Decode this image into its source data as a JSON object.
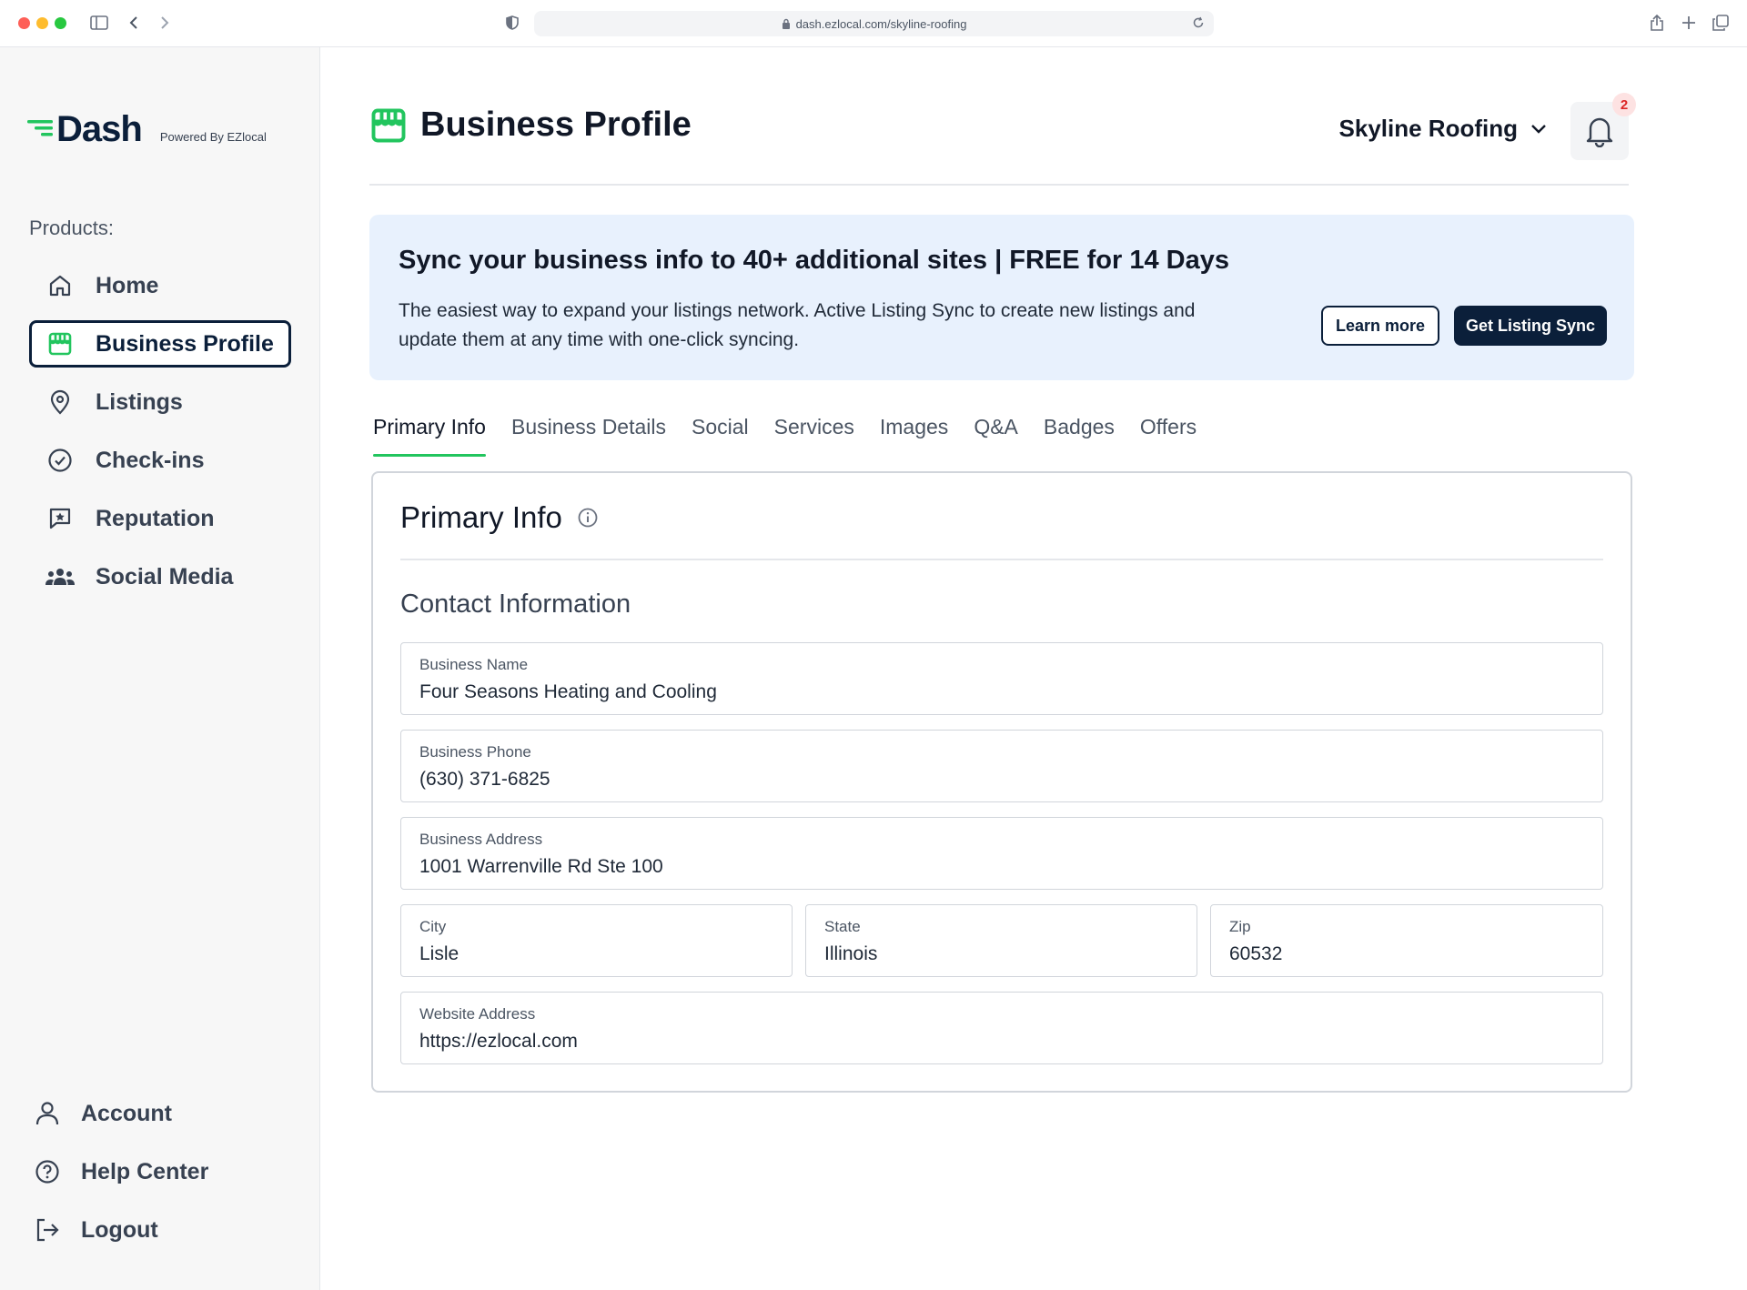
{
  "browser": {
    "url": "dash.ezlocal.com/skyline-roofing"
  },
  "sidebar": {
    "logo_text": "Dash",
    "powered_by": "Powered By EZlocal",
    "products_label": "Products:",
    "items": [
      {
        "label": "Home",
        "icon": "home-icon"
      },
      {
        "label": "Business Profile",
        "icon": "storefront-icon"
      },
      {
        "label": "Listings",
        "icon": "map-pin-icon"
      },
      {
        "label": "Check-ins",
        "icon": "check-circle-icon"
      },
      {
        "label": "Reputation",
        "icon": "star-message-icon"
      },
      {
        "label": "Social Media",
        "icon": "people-icon"
      }
    ],
    "bottom_items": [
      {
        "label": "Account",
        "icon": "user-icon"
      },
      {
        "label": "Help Center",
        "icon": "help-circle-icon"
      },
      {
        "label": "Logout",
        "icon": "logout-icon"
      }
    ]
  },
  "header": {
    "title": "Business Profile",
    "business_name": "Skyline Roofing",
    "notification_count": "2"
  },
  "banner": {
    "title": "Sync your business info to 40+ additional sites | FREE for 14 Days",
    "body": "The easiest way to expand your listings network. Active Listing Sync to create new listings and update them at any time with one-click syncing.",
    "learn_more": "Learn more",
    "cta": "Get Listing Sync"
  },
  "tabs": [
    "Primary Info",
    "Business Details",
    "Social",
    "Services",
    "Images",
    "Q&A",
    "Badges",
    "Offers"
  ],
  "card": {
    "title": "Primary Info",
    "section": "Contact Information",
    "fields": {
      "business_name": {
        "label": "Business Name",
        "value": "Four Seasons Heating and Cooling"
      },
      "business_phone": {
        "label": "Business Phone",
        "value": "(630) 371-6825"
      },
      "business_address": {
        "label": "Business Address",
        "value": "1001 Warrenville Rd Ste 100"
      },
      "city": {
        "label": "City",
        "value": "Lisle"
      },
      "state": {
        "label": "State",
        "value": "Illinois"
      },
      "zip": {
        "label": "Zip",
        "value": "60532"
      },
      "website": {
        "label": "Website Address",
        "value": "https://ezlocal.com"
      }
    }
  },
  "colors": {
    "brand_navy": "#0b1f3a",
    "accent_green": "#22c55e",
    "banner_bg": "#e8f1fd"
  }
}
